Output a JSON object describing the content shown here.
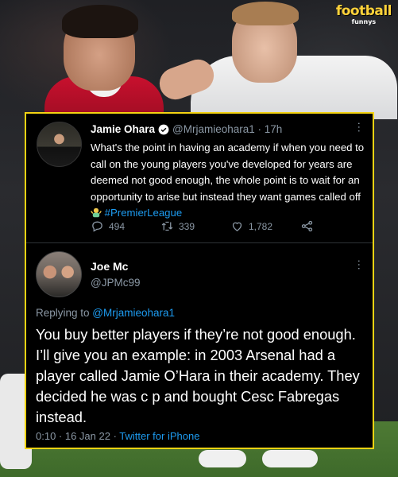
{
  "logo": {
    "main": "football",
    "sub": "funnys"
  },
  "tweet1": {
    "name": "Jamie Ohara",
    "handle": "@Mrjamieohara1 · 17h",
    "text": "What's the point in having an academy if when you need to call on the young players you've developed for years are deemed not good enough, the whole point is to wait for an opportunity to arise but instead they want games called off",
    "hashtag": "#PremierLeague",
    "replies": "494",
    "retweets": "339",
    "likes": "1,782"
  },
  "tweet2": {
    "name": "Joe Mc",
    "handle": "@JPMc99",
    "replying_prefix": "Replying to ",
    "replying_to": "@Mrjamieohara1",
    "text": "You buy better players if they’re not good enough. I’ll give you an example: in 2003 Arsenal had a player called Jamie O’Hara in their academy. They decided he was c   p and bought Cesc Fabregas instead.",
    "timestamp": "0:10 · 16 Jan 22 · ",
    "source": "Twitter for iPhone"
  },
  "colors": {
    "accent": "#1d9bf0",
    "border": "#f4d312",
    "muted": "#8b98a5"
  },
  "icons": [
    "verified-badge-icon",
    "more-dots-icon",
    "reply-icon",
    "retweet-icon",
    "like-icon",
    "share-icon",
    "shrug-emoji-icon"
  ]
}
